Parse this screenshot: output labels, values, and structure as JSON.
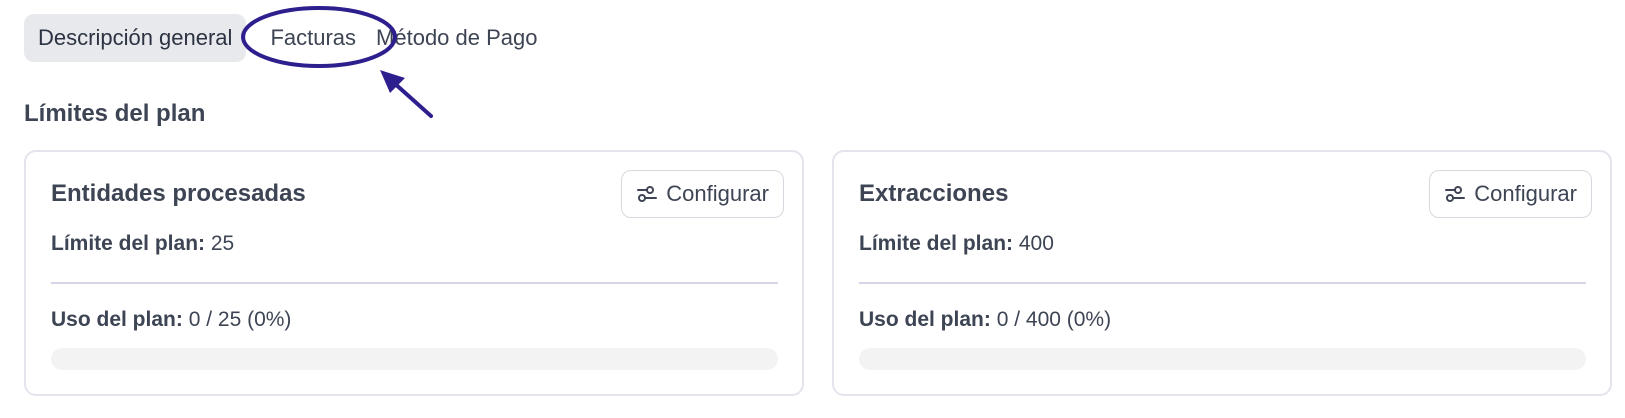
{
  "tabs": [
    {
      "label": "Descripción general",
      "active": true
    },
    {
      "label": "Facturas",
      "active": false
    },
    {
      "label": "Método de Pago",
      "active": false
    }
  ],
  "section": {
    "title": "Límites del plan"
  },
  "cards": [
    {
      "title": "Entidades procesadas",
      "config_label": "Configurar",
      "limit_label": "Límite del plan:",
      "limit_value": "25",
      "usage_label": "Uso del plan:",
      "usage_value": "0 / 25 (0%)",
      "usage_fraction": 0
    },
    {
      "title": "Extracciones",
      "config_label": "Configurar",
      "limit_label": "Límite del plan:",
      "limit_value": "400",
      "usage_label": "Uso del plan:",
      "usage_value": "0 / 400 (0%)",
      "usage_fraction": 0
    }
  ],
  "icons": {
    "config": "sliders-icon"
  },
  "colors": {
    "annotation": "#2e1f8f",
    "progress_track": "#f3f3f4",
    "active_tab_bg": "#e8e9ec"
  }
}
